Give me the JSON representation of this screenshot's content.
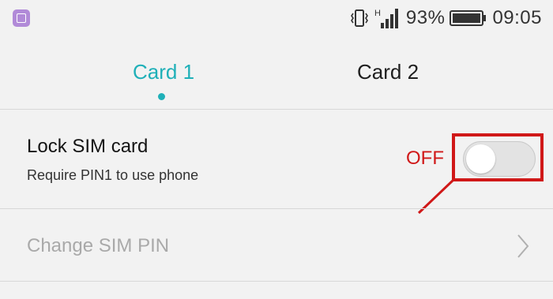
{
  "status_bar": {
    "battery_percent": "93%",
    "time": "09:05",
    "network_label": "H",
    "icons": [
      "gallery-app-icon",
      "vibrate-icon",
      "signal-icon",
      "battery-icon"
    ]
  },
  "tabs": [
    {
      "label": "Card 1",
      "active": true
    },
    {
      "label": "Card 2",
      "active": false
    }
  ],
  "lock_sim": {
    "title": "Lock SIM card",
    "subtitle": "Require PIN1 to use phone",
    "toggle_state": "OFF"
  },
  "change_pin": {
    "title": "Change SIM PIN"
  },
  "colors": {
    "accent": "#1fb0b8",
    "annotation": "#d01818",
    "background": "#f2f2f2"
  }
}
